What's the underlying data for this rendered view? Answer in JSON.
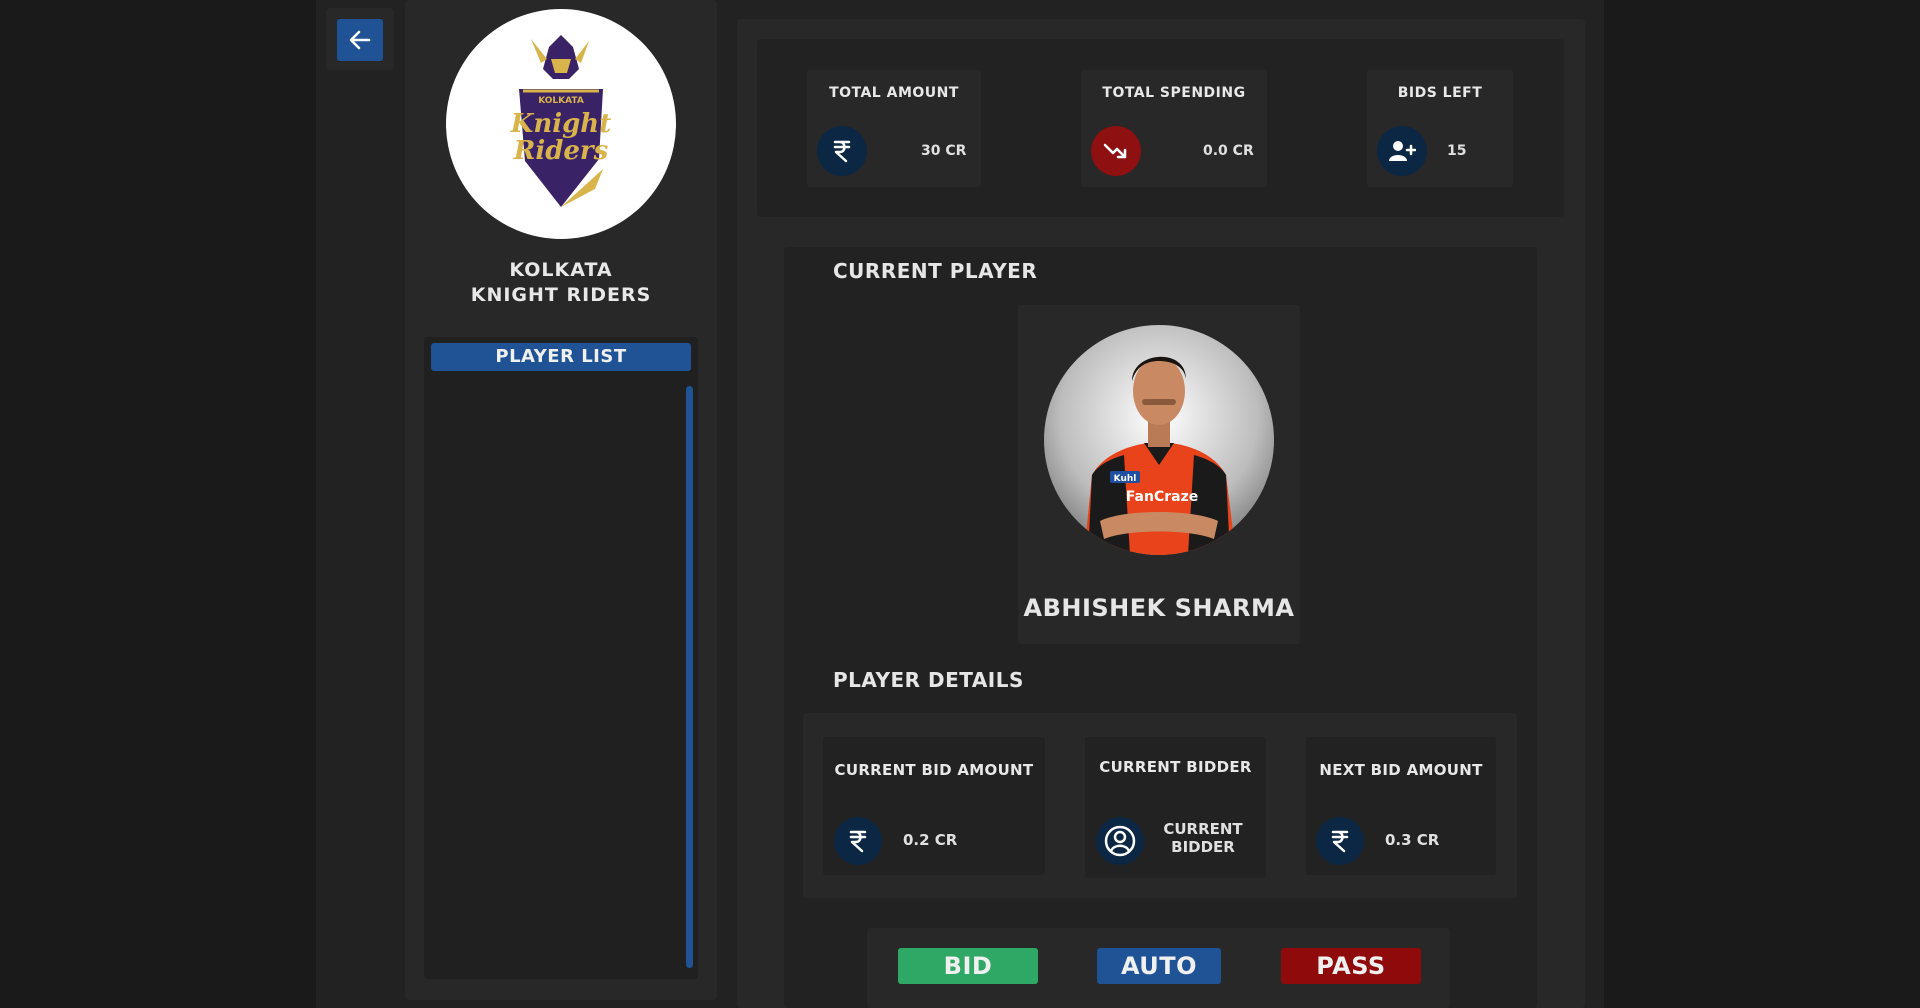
{
  "team": {
    "name_line1": "KOLKATA",
    "name_line2": "KNIGHT RIDERS",
    "logo_text_top": "KOLKATA",
    "logo_text_main1": "Knight",
    "logo_text_main2": "Riders"
  },
  "player_list": {
    "header": "PLAYER LIST"
  },
  "stats": {
    "total_amount": {
      "title": "TOTAL AMOUNT",
      "value": "30 CR",
      "icon": "rupee-icon"
    },
    "total_spending": {
      "title": "TOTAL SPENDING",
      "value": "0.0 CR",
      "icon": "trending-down-icon"
    },
    "bids_left": {
      "title": "BIDS LEFT",
      "value": "15",
      "icon": "user-add-icon"
    }
  },
  "current_player": {
    "section_title": "CURRENT PLAYER",
    "name": "ABHISHEK SHARMA",
    "jersey_text": "FanCraze",
    "sponsor_text": "Kuhl"
  },
  "player_details": {
    "section_title": "PLAYER DETAILS",
    "current_bid": {
      "title": "CURRENT BID AMOUNT",
      "value": "0.2 CR",
      "icon": "rupee-icon"
    },
    "current_bidder": {
      "title": "CURRENT BIDDER",
      "value_line1": "CURRENT",
      "value_line2": "BIDDER",
      "icon": "user-circle-icon"
    },
    "next_bid": {
      "title": "NEXT BID AMOUNT",
      "value": "0.3 CR",
      "icon": "rupee-icon"
    }
  },
  "actions": {
    "bid": "BID",
    "auto": "AUTO",
    "pass": "PASS"
  },
  "colors": {
    "accent_blue": "#1f5396",
    "bid_green": "#2fa866",
    "pass_red": "#8f0b0b",
    "icon_navy": "#0b2744",
    "icon_red": "#8f1010",
    "kkr_purple": "#3a2266",
    "kkr_gold": "#d8b44a"
  }
}
